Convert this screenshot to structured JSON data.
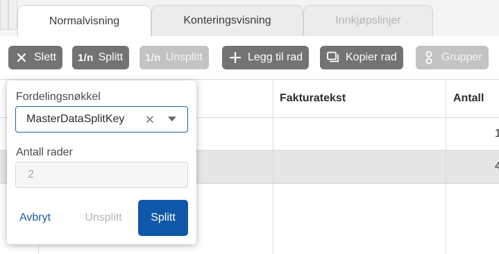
{
  "tabs": [
    {
      "label": "Normalvisning",
      "state": "active"
    },
    {
      "label": "Konteringsvisning",
      "state": "normal"
    },
    {
      "label": "Innkjøpslinjer",
      "state": "disabled"
    }
  ],
  "toolbar": {
    "buttons": [
      {
        "label": "Slett",
        "icon": "close-icon",
        "enabled": true
      },
      {
        "label": "Splitt",
        "icon_text": "1/n",
        "icon": "split-icon",
        "enabled": true
      },
      {
        "label": "Unsplitt",
        "icon_text": "1/n",
        "icon": "unsplit-icon",
        "enabled": false
      },
      {
        "label": "Legg til rad",
        "icon": "plus-icon",
        "enabled": true
      },
      {
        "label": "Kopier rad",
        "icon": "copy-icon",
        "enabled": true
      },
      {
        "label": "Grupper",
        "icon": "group-icon",
        "enabled": false
      }
    ]
  },
  "grid": {
    "columns": [
      "Fakturatekst",
      "Antall"
    ],
    "rows": [
      {
        "antall_partial": "1"
      },
      {
        "antall_partial": "4"
      }
    ]
  },
  "split_popup": {
    "key_label": "Fordelingsnøkkel",
    "key_value": "MasterDataSplitKey",
    "rows_label": "Antall rader",
    "rows_value": "2",
    "cancel_label": "Avbryt",
    "unsplit_label": "Unsplitt",
    "split_label": "Splitt"
  },
  "colors": {
    "primary": "#0f57a8",
    "focus_border": "#1f5fa8",
    "toolbar_button": "#737373",
    "toolbar_button_disabled": "#c3c3c3",
    "selected_row": "#e6e6e6"
  }
}
